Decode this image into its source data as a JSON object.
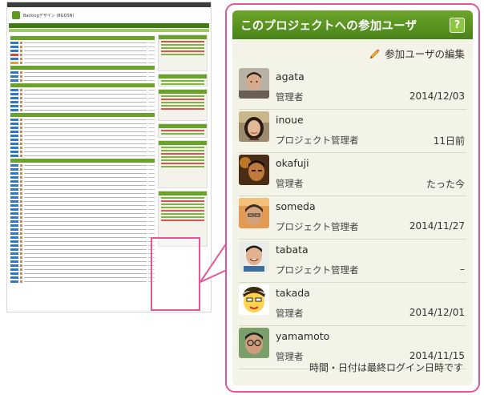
{
  "thumbnail": {
    "app_title": "Backlogデザイン (BGDSN)"
  },
  "panel": {
    "title": "このプロジェクトへの参加ユーザ",
    "help_label": "?",
    "edit_label": "参加ユーザの編集",
    "members": [
      {
        "name": "agata",
        "role": "管理者",
        "last_login": "2014/12/03",
        "avatar": "photo-man"
      },
      {
        "name": "inoue",
        "role": "プロジェクト管理者",
        "last_login": "11日前",
        "avatar": "photo-woman"
      },
      {
        "name": "okafuji",
        "role": "管理者",
        "last_login": "たった今",
        "avatar": "photo-dark"
      },
      {
        "name": "someda",
        "role": "プロジェクト管理者",
        "last_login": "2014/11/27",
        "avatar": "photo-warm"
      },
      {
        "name": "tabata",
        "role": "プロジェクト管理者",
        "last_login": "–",
        "avatar": "photo-smile"
      },
      {
        "name": "takada",
        "role": "管理者",
        "last_login": "2014/12/01",
        "avatar": "illustration-face"
      },
      {
        "name": "yamamoto",
        "role": "管理者",
        "last_login": "2014/11/15",
        "avatar": "photo-glasses"
      }
    ],
    "footer_note": "時間・日付は最終ログイン日時です"
  },
  "colors": {
    "accent_green": "#5c9a1e",
    "highlight_pink": "#e0579a",
    "panel_bg": "#f3f3e8"
  }
}
